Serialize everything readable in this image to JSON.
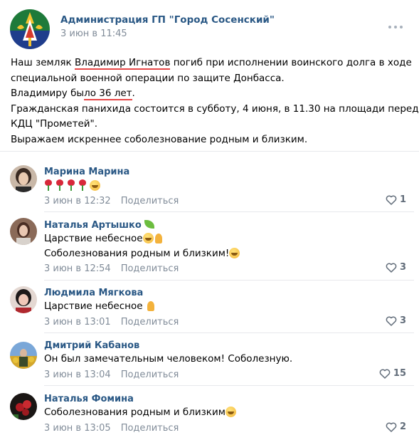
{
  "post": {
    "group_name": "Администрация ГП \"Город Сосенский\"",
    "date": "3 июн в 11:45",
    "text": {
      "l1_a": "Наш земляк ",
      "l1_b": "Владимир Игнатов",
      "l1_c": " погиб при исполнении воинского долга в ходе",
      "l2": "специальной военной операции по защите Донбасса.",
      "l3_a": "Владимиру бы",
      "l3_b": "ло 36 лет",
      "l3_c": ".",
      "l4": "Гражданская панихида состоится в субботу, 4 июня, в 11.30 на площади перед",
      "l5": "КДЦ \"Прометей\".",
      "l6": "Выражаем искреннее соболезнование родным и близким."
    }
  },
  "comments": [
    {
      "author": "Марина Марина",
      "lines": [
        ""
      ],
      "date": "3 июн в 12:32",
      "reply": "Поделиться",
      "likes": "1"
    },
    {
      "author": "Наталья Артышко",
      "lines": [
        "Царствие небесное",
        "Соболезнования родным и близким!"
      ],
      "date": "3 июн в 12:54",
      "reply": "Поделиться",
      "likes": "3"
    },
    {
      "author": "Людмила Мягкова",
      "lines": [
        "Царствие небесное "
      ],
      "date": "3 июн в 13:01",
      "reply": "Поделиться",
      "likes": "3"
    },
    {
      "author": "Дмитрий Кабанов",
      "lines": [
        "Он был замечательным человеком! Соболезную."
      ],
      "date": "3 июн в 13:04",
      "reply": "Поделиться",
      "likes": "15"
    },
    {
      "author": "Наталья Фомина",
      "lines": [
        "Соболезнования родным и близким"
      ],
      "date": "3 июн в 13:05",
      "reply": "Поделиться",
      "likes": "2"
    }
  ],
  "icons": {
    "more": "more-dots-icon",
    "like": "heart-outline-icon"
  },
  "colors": {
    "link": "#2a5885",
    "meta": "#818c99",
    "underline": "#e64646"
  }
}
